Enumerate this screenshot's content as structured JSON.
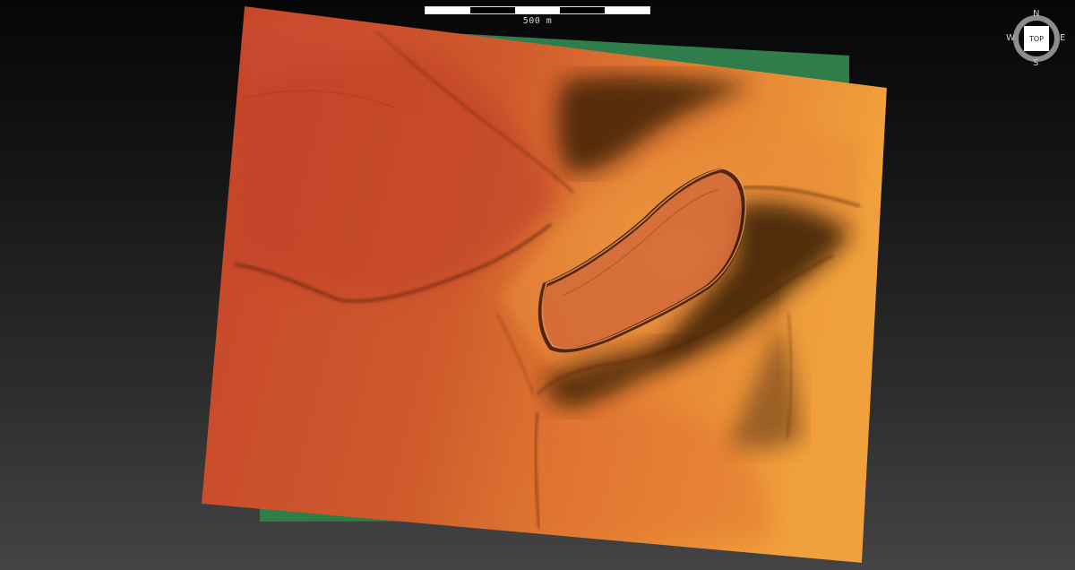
{
  "scale_bar": {
    "label": "500 m",
    "segments": [
      "white",
      "black",
      "white",
      "black",
      "white"
    ]
  },
  "compass": {
    "north": "N",
    "south": "S",
    "east": "E",
    "west": "W",
    "view_button": "TOP"
  },
  "colors": {
    "background_top": "#060606",
    "background_bottom": "#444444",
    "underlay": "#2e7d4a",
    "terrain_low": "#c5442a",
    "terrain_high": "#f0a03c",
    "shadow": "#2a1206"
  }
}
